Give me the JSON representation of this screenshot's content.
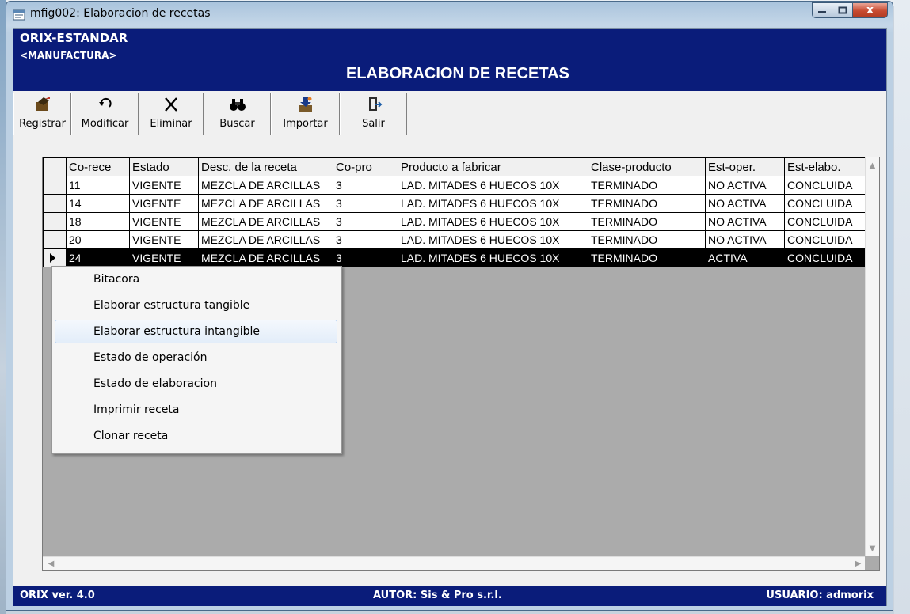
{
  "window": {
    "title": "mfig002: Elaboracion de recetas",
    "minimize_glyph": "–",
    "maximize_glyph": "□",
    "close_glyph": "x"
  },
  "banner": {
    "company": "ORIX-ESTANDAR",
    "module": "<MANUFACTURA>",
    "title": "ELABORACION DE RECETAS"
  },
  "toolbar": [
    {
      "label": "Registrar",
      "icon": "register-icon"
    },
    {
      "label": "Modificar",
      "icon": "undo-arrow-icon"
    },
    {
      "label": "Eliminar",
      "icon": "delete-x-icon"
    },
    {
      "label": "Buscar",
      "icon": "binoculars-icon"
    },
    {
      "label": "Importar",
      "icon": "import-icon"
    },
    {
      "label": "Salir",
      "icon": "exit-door-icon"
    }
  ],
  "grid": {
    "columns": [
      "Co-rece",
      "Estado",
      "Desc. de la receta",
      "Co-pro",
      "Producto a fabricar",
      "Clase-producto",
      "Est-oper.",
      "Est-elabo."
    ],
    "rows": [
      [
        "11",
        "VIGENTE",
        "MEZCLA DE ARCILLAS",
        "3",
        "LAD. MITADES 6 HUECOS 10X",
        "TERMINADO",
        "NO ACTIVA",
        "CONCLUIDA"
      ],
      [
        "14",
        "VIGENTE",
        "MEZCLA DE ARCILLAS",
        "3",
        "LAD. MITADES 6 HUECOS 10X",
        "TERMINADO",
        "NO ACTIVA",
        "CONCLUIDA"
      ],
      [
        "18",
        "VIGENTE",
        "MEZCLA DE ARCILLAS",
        "3",
        "LAD. MITADES 6 HUECOS 10X",
        "TERMINADO",
        "NO ACTIVA",
        "CONCLUIDA"
      ],
      [
        "20",
        "VIGENTE",
        "MEZCLA DE ARCILLAS",
        "3",
        "LAD. MITADES 6 HUECOS 10X",
        "TERMINADO",
        "NO ACTIVA",
        "CONCLUIDA"
      ],
      [
        "24",
        "VIGENTE",
        "MEZCLA DE ARCILLAS",
        "3",
        "LAD. MITADES 6 HUECOS 10X",
        "TERMINADO",
        "ACTIVA",
        "CONCLUIDA"
      ]
    ],
    "selected_row": "24"
  },
  "context_menu": {
    "items": [
      "Bitacora",
      "Elaborar estructura tangible",
      "Elaborar estructura intangible",
      "Estado de operación",
      "Estado de elaboracion",
      "Imprimir receta",
      "Clonar receta"
    ],
    "highlighted": "Elaborar estructura intangible"
  },
  "statusbar": {
    "version": "ORIX ver. 4.0",
    "author": "AUTOR: Sis & Pro s.r.l.",
    "user": "USUARIO: admorix"
  },
  "colors": {
    "banner_bg": "#0a1c7a",
    "selected_row_bg": "#000000",
    "menu_highlight_border": "#a8c8ee"
  }
}
